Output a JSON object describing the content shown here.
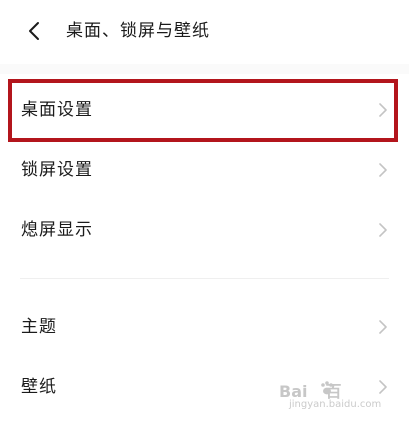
{
  "header": {
    "title": "桌面、锁屏与壁纸"
  },
  "settings": {
    "items": [
      {
        "label": "桌面设置"
      },
      {
        "label": "锁屏设置"
      },
      {
        "label": "熄屏显示"
      },
      {
        "label": "主题"
      },
      {
        "label": "壁纸"
      }
    ]
  },
  "watermark": {
    "brand_left": "Bai",
    "brand_right": "百",
    "url": "jingyan.baidu.com"
  },
  "colors": {
    "highlight_border": "#b3151c",
    "chevron": "#c4c4c4",
    "text": "#1b1b1b"
  },
  "icons": {
    "back": "chevron-left-icon",
    "row_arrow": "chevron-right-icon",
    "watermark_paw": "paw-icon"
  }
}
